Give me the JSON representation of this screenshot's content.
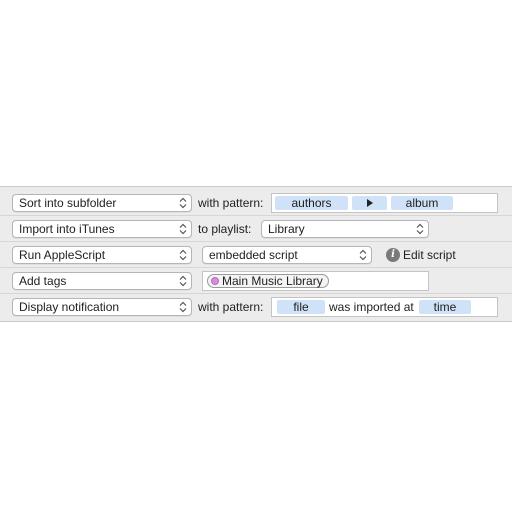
{
  "actions": [
    {
      "action": "Sort into subfolder",
      "connector": "with pattern:",
      "tokens": [
        "authors",
        "album"
      ],
      "separator_icon": "triangle-right-icon"
    },
    {
      "action": "Import into iTunes",
      "connector": "to playlist:",
      "playlist": "Library"
    },
    {
      "action": "Run AppleScript",
      "script_source": "embedded script",
      "info_icon": "info-icon",
      "edit_label": "Edit script"
    },
    {
      "action": "Add tags",
      "tag": "Main Music Library",
      "tag_color": "#d98be0"
    },
    {
      "action": "Display notification",
      "connector": "with pattern:",
      "token_1": "file",
      "text": "was imported at",
      "token_2": "time"
    }
  ],
  "colors": {
    "token_background": "#cfe2f7",
    "panel_background": "#ececec"
  }
}
